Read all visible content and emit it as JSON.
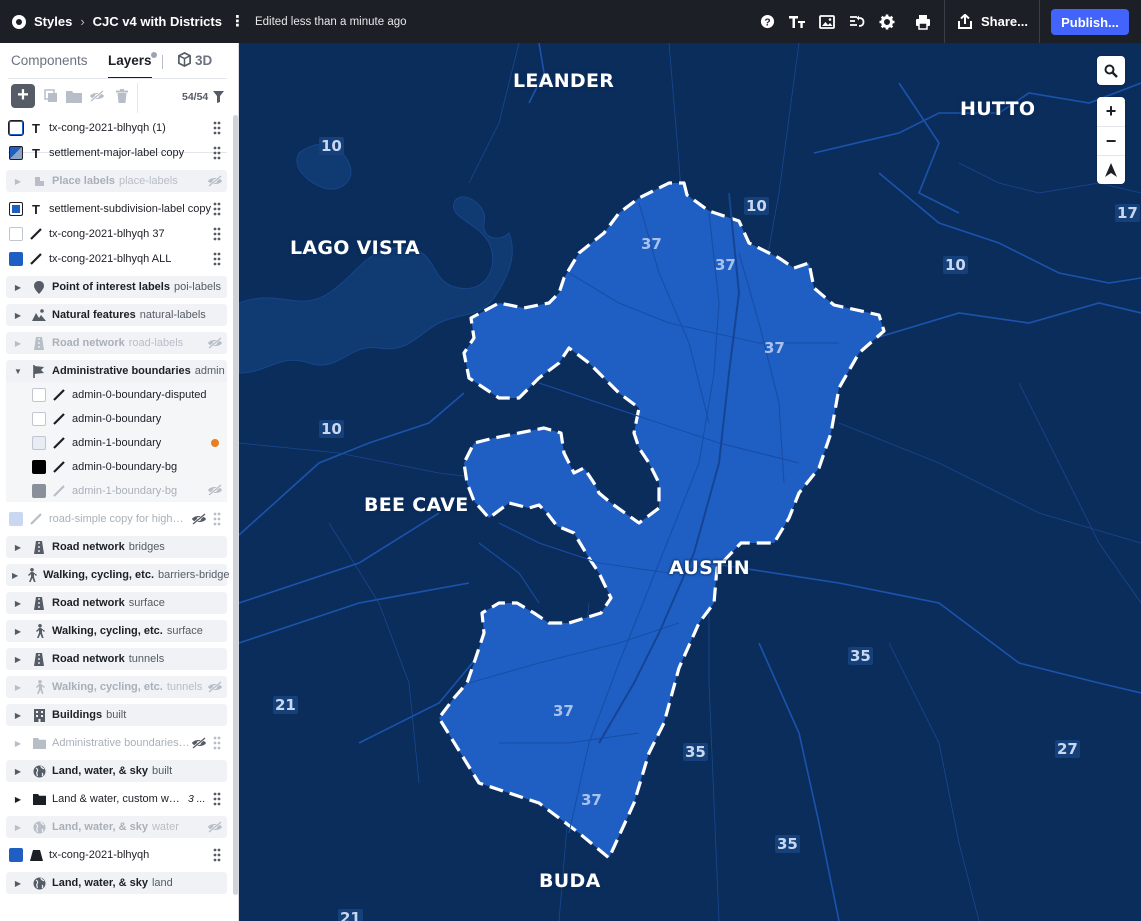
{
  "topbar": {
    "styles_label": "Styles",
    "style_name": "CJC v4 with Districts",
    "edited": "Edited less than a minute ago",
    "share_label": "Share...",
    "publish_label": "Publish..."
  },
  "sidebar": {
    "tabs": {
      "components": "Components",
      "layers": "Layers",
      "three_d": "3D"
    },
    "count": "54/54",
    "layers": [
      {
        "name": "tx-cong-2021-blhyqh (1)"
      },
      {
        "name": "settlement-major-label copy"
      },
      {
        "group": "Place labels",
        "source": "place-labels"
      },
      {
        "name": "settlement-subdivision-label copy"
      },
      {
        "name": "tx-cong-2021-blhyqh 37"
      },
      {
        "name": "tx-cong-2021-blhyqh ALL"
      },
      {
        "group": "Point of interest labels",
        "source": "poi-labels"
      },
      {
        "group": "Natural features",
        "source": "natural-labels"
      },
      {
        "group": "Road network",
        "source": "road-labels"
      },
      {
        "group": "Administrative boundaries",
        "source": "admin"
      },
      {
        "name": "admin-0-boundary-disputed"
      },
      {
        "name": "admin-0-boundary"
      },
      {
        "name": "admin-1-boundary"
      },
      {
        "name": "admin-0-boundary-bg"
      },
      {
        "name": "admin-1-boundary-bg"
      },
      {
        "name": "road-simple copy for highwa..."
      },
      {
        "group": "Road network",
        "source": "bridges"
      },
      {
        "group": "Walking, cycling, etc.",
        "source": "barriers-bridge"
      },
      {
        "group": "Road network",
        "source": "surface"
      },
      {
        "group": "Walking, cycling, etc.",
        "source": "surface"
      },
      {
        "group": "Road network",
        "source": "tunnels"
      },
      {
        "group": "Walking, cycling, etc.",
        "source": "tunnels"
      },
      {
        "group": "Buildings",
        "source": "built"
      },
      {
        "name": "Administrative boundaries, ..."
      },
      {
        "group": "Land, water, & sky",
        "source": "built"
      },
      {
        "name": "Land & water, custom water",
        "badge": "3 ..."
      },
      {
        "group": "Land, water, & sky",
        "source": "water"
      },
      {
        "name": "tx-cong-2021-blhyqh"
      },
      {
        "group": "Land, water, & sky",
        "source": "land"
      }
    ]
  },
  "map": {
    "cities": [
      "LEANDER",
      "HUTTO",
      "LAGO VISTA",
      "BEE CAVE",
      "AUSTIN",
      "BUDA"
    ],
    "highway_shields": [
      "10",
      "10",
      "10",
      "10",
      "17",
      "21",
      "21",
      "35",
      "35",
      "35",
      "27"
    ],
    "district_numbers": [
      "37",
      "37",
      "37",
      "37",
      "37"
    ],
    "colors": {
      "background": "#0b2d5c",
      "district_fill": "#1f5fc4",
      "district_outline": "#ffffff",
      "accent": "#4264fb"
    }
  }
}
